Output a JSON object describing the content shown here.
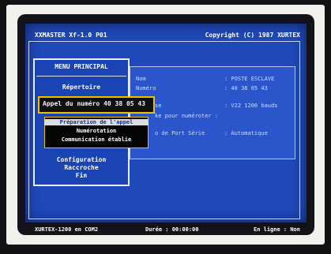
{
  "title_bar": {
    "app_name": "XXMASTER Xf-1.0 P01",
    "copyright": "Copyright (C) 1987 XURTEX"
  },
  "fields": [
    {
      "label": "Nom",
      "value": ": POSTE ESCLAVE"
    },
    {
      "label": "Numéro",
      "value": ": 40 38 05 43"
    },
    {
      "label": "se",
      "value": ": V22 1200 bauds"
    },
    {
      "label": "ke pour numéroter :",
      "value": ""
    },
    {
      "label": "o de Port Série",
      "value": ": Automatique"
    }
  ],
  "menu": {
    "title": "MENU PRINCIPAL",
    "items": [
      {
        "label": "Répertoire"
      },
      {
        "label": "Configuration"
      },
      {
        "label": "Raccroche"
      },
      {
        "label": "Fin"
      }
    ]
  },
  "dial_popup": {
    "title": "Appel du numéro 40 38 05 43",
    "items": [
      {
        "label": "Préparation de l'appel",
        "selected": true
      },
      {
        "label": "Numérotation",
        "selected": false
      },
      {
        "label": "Communication établie",
        "selected": false
      }
    ]
  },
  "status_bar": {
    "device": "XURTEX-1200 en COM2",
    "duration": "Durée : 00:00:00",
    "online": "En ligne : Non"
  },
  "colors": {
    "background": "#1f48b8",
    "popup_border": "#e8c200",
    "highlight": "#dcdcdc"
  }
}
